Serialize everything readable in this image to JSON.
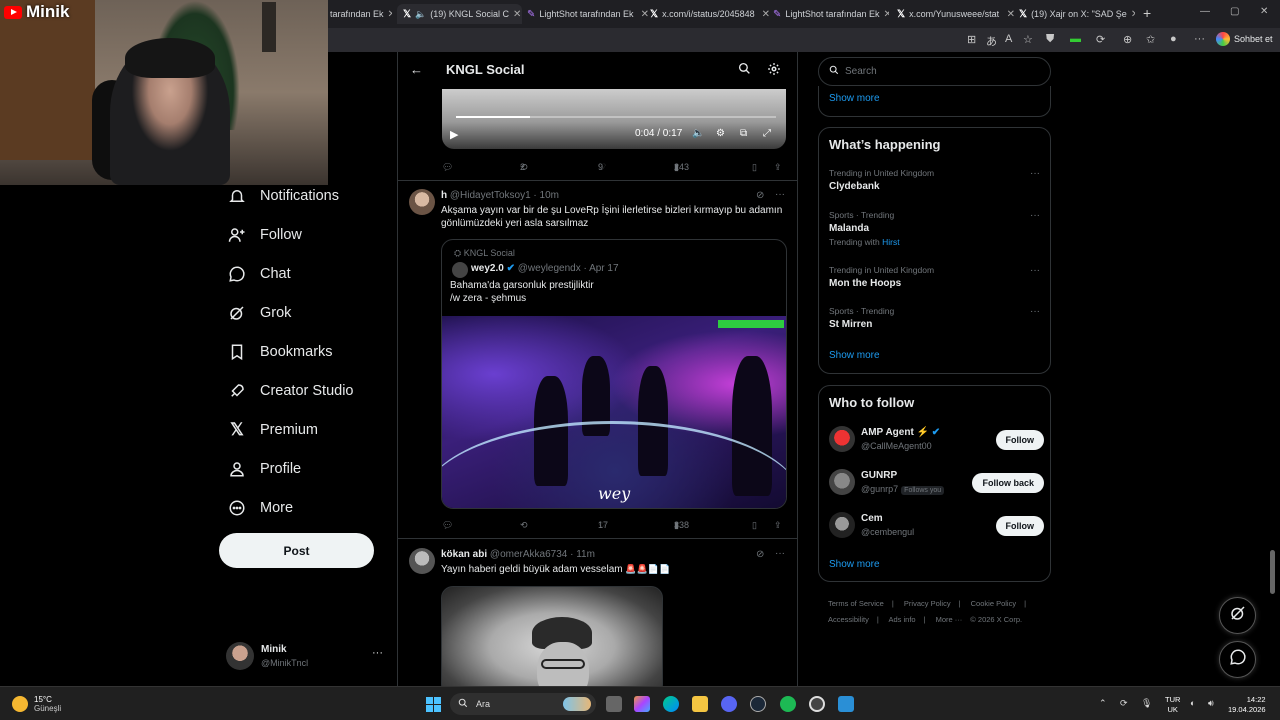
{
  "browser": {
    "tabs": [
      {
        "label": "tarafından Ek",
        "icon": "lightshot-icon"
      },
      {
        "label": "(19) KNGL Social C",
        "icon": "x-logo-icon",
        "active": true
      },
      {
        "label": "LightShot tarafından Ek",
        "icon": "lightshot-icon"
      },
      {
        "label": "x.com/i/status/2045848",
        "icon": "x-logo-icon"
      },
      {
        "label": "LightShot tarafından Ek",
        "icon": "lightshot-icon"
      },
      {
        "label": "x.com/Yunusweee/stat",
        "icon": "x-logo-icon"
      },
      {
        "label": "(19) Xajr on X: \"SAD Şe",
        "icon": "x-logo-icon"
      }
    ],
    "chat_button": "Sohbet et"
  },
  "stream_overlay": {
    "channel": "Minik"
  },
  "nav": {
    "items": [
      {
        "label": "Notifications",
        "icon": "bell-icon"
      },
      {
        "label": "Follow",
        "icon": "follow-icon"
      },
      {
        "label": "Chat",
        "icon": "chat-icon"
      },
      {
        "label": "Grok",
        "icon": "grok-icon"
      },
      {
        "label": "Bookmarks",
        "icon": "bookmark-icon"
      },
      {
        "label": "Creator Studio",
        "icon": "rocket-icon"
      },
      {
        "label": "Premium",
        "icon": "x-logo-icon"
      },
      {
        "label": "Profile",
        "icon": "person-icon"
      },
      {
        "label": "More",
        "icon": "more-circle-icon"
      }
    ],
    "post_label": "Post",
    "account": {
      "name": "Minik",
      "handle": "@MinikTncl"
    }
  },
  "header": {
    "title": "KNGL Social"
  },
  "video1": {
    "time": "0:04 / 0:17",
    "progress": 0.23
  },
  "tweet1_actions": {
    "reply": "",
    "repost": "2",
    "like": "9",
    "views": "243"
  },
  "tweet2": {
    "name": "h",
    "handle": "@HidayetToksoy1",
    "time": "10m",
    "text": "Akşama yayın var bir de şu LoveRp İşini ilerletirse bizleri kırmayıp bu adamın gönlümüzdeki yeri asla sarsılmaz",
    "quote": {
      "source": "KNGL Social",
      "name": "wey2.0",
      "handle": "@weylegendx",
      "date": "Apr 17",
      "text_line1": "Bahama'da garsonluk prestijliktir",
      "text_line2": "/w zera - şehmus",
      "watermark": "wey"
    },
    "actions": {
      "reply": "",
      "repost": "",
      "like": "17",
      "views": "338"
    }
  },
  "tweet3": {
    "name": "kökan abi",
    "handle": "@omerAkka6734",
    "time": "11m",
    "text": "Yayın haberi geldi büyük adam vesselam"
  },
  "right": {
    "search_placeholder": "Search",
    "show_more": "Show more",
    "happening_title": "What’s happening",
    "trends": [
      {
        "context": "Trending in United Kingdom",
        "topic": "Clydebank",
        "with": ""
      },
      {
        "context": "Sports · Trending",
        "topic": "Malanda",
        "with_prefix": "Trending with",
        "with": "Hirst"
      },
      {
        "context": "Trending in United Kingdom",
        "topic": "Mon the Hoops",
        "with": ""
      },
      {
        "context": "Sports · Trending",
        "topic": "St Mirren",
        "with": ""
      }
    ],
    "who_title": "Who to follow",
    "who": [
      {
        "name": "AMP Agent ⚡",
        "handle": "@CallMeAgent00",
        "button": "Follow",
        "verified": true
      },
      {
        "name": "GUNRP",
        "handle": "@gunrp7",
        "follows_you": "Follows you",
        "button": "Follow back"
      },
      {
        "name": "Cem",
        "handle": "@cembengul",
        "button": "Follow"
      }
    ],
    "footer": [
      "Terms of Service",
      "|",
      "Privacy Policy",
      "|",
      "Cookie Policy",
      "|",
      "Accessibility",
      "|",
      "Ads info",
      "|",
      "More ···",
      "© 2026 X Corp."
    ]
  },
  "taskbar": {
    "weather_temp": "15°C",
    "weather_desc": "Güneşli",
    "search_label": "Ara",
    "lang_line1": "TUR",
    "lang_line2": "UK",
    "time": "14:22",
    "date": "19.04.2026"
  }
}
